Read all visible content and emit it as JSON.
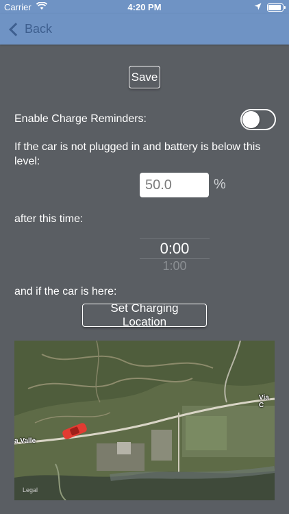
{
  "status_bar": {
    "carrier": "Carrier",
    "time": "4:20 PM",
    "icons": [
      "wifi-icon",
      "location-arrow-icon",
      "battery-icon"
    ]
  },
  "nav": {
    "back_label": "Back",
    "back_icon": "chevron-left-icon"
  },
  "form": {
    "save_label": "Save",
    "enable_label": "Enable Charge Reminders:",
    "enable_on": false,
    "battery_text": "If the car is not plugged in and battery is below this level:",
    "battery_value": "50.0",
    "percent_sign": "%",
    "time_text": "after this time:",
    "time_picker": {
      "selected": "0:00",
      "next": "1:00"
    },
    "location_text": "and if the car is here:",
    "set_location_label": "Set Charging Location"
  },
  "map": {
    "street_left": "a Valle",
    "street_right": "Via C",
    "legal": "Legal",
    "car_color": "#e23b32"
  },
  "colors": {
    "background": "#5a5e63",
    "navbar": "#6f93c4",
    "back_text": "#3e5f8f"
  }
}
